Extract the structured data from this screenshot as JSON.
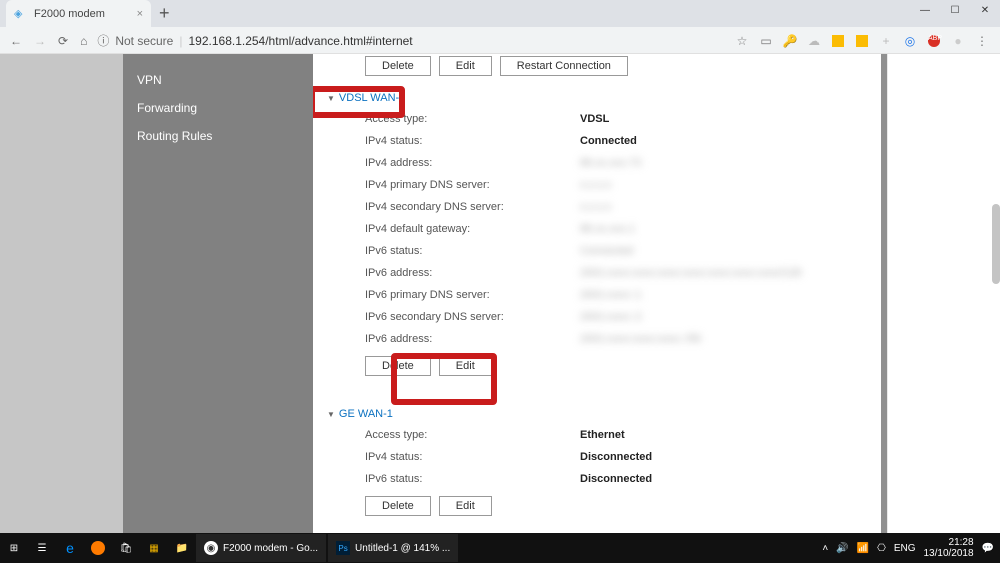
{
  "browser": {
    "tab_title": "F2000 modem",
    "security_text": "Not secure",
    "url": "192.168.1.254/html/advance.html#internet"
  },
  "sidebar": {
    "items": [
      "VPN",
      "Forwarding",
      "Routing Rules"
    ]
  },
  "top_buttons": {
    "delete": "Delete",
    "edit": "Edit",
    "restart": "Restart Connection"
  },
  "vdsl": {
    "header": "VDSL WAN-1",
    "rows": [
      {
        "label": "Access type:",
        "value": "VDSL",
        "blur": false
      },
      {
        "label": "IPv4 status:",
        "value": "Connected",
        "blur": false
      },
      {
        "label": "IPv4 address:",
        "value": "86.xx.xxx.73",
        "blur": true
      },
      {
        "label": "IPv4 primary DNS server:",
        "value": "x.x.x.x",
        "blur": true
      },
      {
        "label": "IPv4 secondary DNS server:",
        "value": "x.x.x.x",
        "blur": true
      },
      {
        "label": "IPv4 default gateway:",
        "value": "86.xx.xxx.1",
        "blur": true
      },
      {
        "label": "IPv6 status:",
        "value": "Connected",
        "blur": true
      },
      {
        "label": "IPv6 address:",
        "value": "2001:xxxx:xxxx:xxxx:xxxx:xxxx:xxxx:xxxx/128",
        "blur": true
      },
      {
        "label": "IPv6 primary DNS server:",
        "value": "2001:xxxx::1",
        "blur": true
      },
      {
        "label": "IPv6 secondary DNS server:",
        "value": "2001:xxxx::2",
        "blur": true
      },
      {
        "label": "IPv6 address:",
        "value": "2001:xxxx:xxxx:xxxx::/56",
        "blur": true
      }
    ],
    "buttons": {
      "delete": "Delete",
      "edit": "Edit"
    }
  },
  "ge": {
    "header": "GE WAN-1",
    "rows": [
      {
        "label": "Access type:",
        "value": "Ethernet",
        "blur": false
      },
      {
        "label": "IPv4 status:",
        "value": "Disconnected",
        "blur": false
      },
      {
        "label": "IPv6 status:",
        "value": "Disconnected",
        "blur": false
      }
    ],
    "buttons": {
      "delete": "Delete",
      "edit": "Edit"
    }
  },
  "taskbar": {
    "apps": [
      {
        "label": "F2000 modem - Go...",
        "icon": "chrome"
      },
      {
        "label": "Untitled-1 @ 141% ...",
        "icon": "ps"
      }
    ],
    "lang": "ENG",
    "time": "21:28",
    "date": "13/10/2018"
  }
}
